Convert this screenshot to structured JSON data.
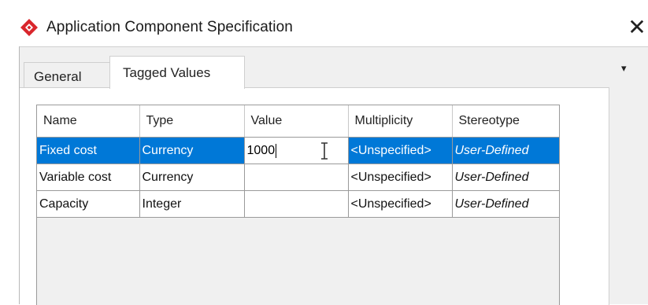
{
  "window": {
    "title": "Application Component Specification",
    "close_glyph": "✕",
    "app_icon": "visual-paradigm-logo"
  },
  "tabs": [
    {
      "label": "General",
      "active": false
    },
    {
      "label": "Tagged Values",
      "active": true
    }
  ],
  "tab_overflow_icon": "▾",
  "table": {
    "columns": [
      "Name",
      "Type",
      "Value",
      "Multiplicity",
      "Stereotype"
    ],
    "rows": [
      {
        "name": "Fixed cost",
        "type": "Currency",
        "value": "1000",
        "multiplicity": "<Unspecified>",
        "stereotype": "User-Defined",
        "selected": true
      },
      {
        "name": "Variable cost",
        "type": "Currency",
        "value": "",
        "multiplicity": "<Unspecified>",
        "stereotype": "User-Defined",
        "selected": false
      },
      {
        "name": "Capacity",
        "type": "Integer",
        "value": "",
        "multiplicity": "<Unspecified>",
        "stereotype": "User-Defined",
        "selected": false
      }
    ]
  },
  "colors": {
    "selection": "#0078d7",
    "logo_red": "#d9262c",
    "window_background": "#f0f0f0"
  }
}
